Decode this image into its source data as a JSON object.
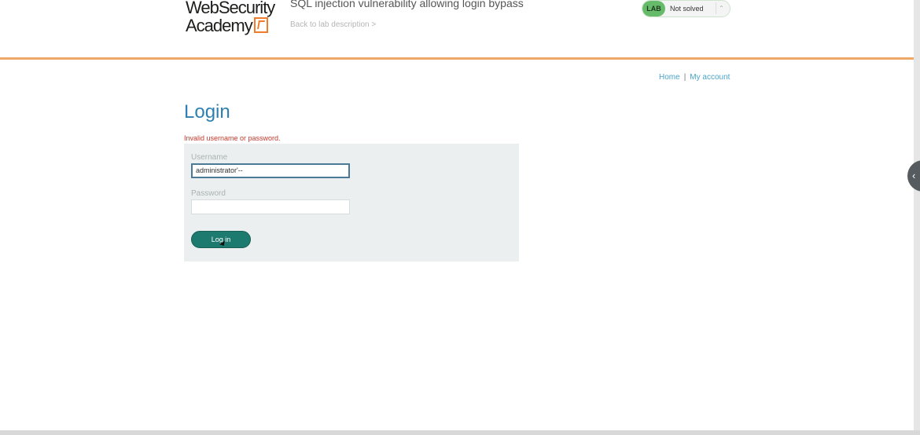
{
  "header": {
    "logo_line1": "WebSecurity",
    "logo_line2": "Academy",
    "lab_title": "SQL injection vulnerability allowing login bypass",
    "back_link": "Back to lab description  >",
    "status_badge": "LAB",
    "status_text": "Not solved"
  },
  "nav": {
    "home": "Home",
    "separator": "|",
    "my_account": "My account"
  },
  "main": {
    "title": "Login",
    "error": "Invalid username or password.",
    "username_label": "Username",
    "username_value": "administrator'--",
    "password_label": "Password",
    "password_value": "",
    "login_button": "Log in"
  },
  "colors": {
    "accent_orange": "#f0a868",
    "title_blue": "#2d7fb0",
    "error_red": "#c0392b",
    "button_teal": "#1d7a6e",
    "lab_green": "#66bb6a"
  },
  "icons": {
    "status_toggle": "chevron-updown-icon",
    "side_handle": "chevron-left-icon",
    "cursor": "mouse-pointer-icon"
  }
}
